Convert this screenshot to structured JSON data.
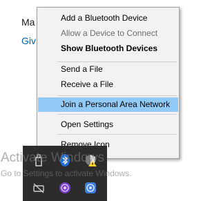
{
  "background": {
    "line1": "Ma",
    "line2": "Giv"
  },
  "menu": {
    "items": [
      {
        "label": "Add a Bluetooth Device"
      },
      {
        "label": "Allow a Device to Connect"
      },
      {
        "label": "Show Bluetooth Devices"
      },
      {
        "label": "Send a File"
      },
      {
        "label": "Receive a File"
      },
      {
        "label": "Join a Personal Area Network"
      },
      {
        "label": "Open Settings"
      },
      {
        "label": "Remove Icon"
      }
    ]
  },
  "watermark": {
    "title": "Activate Windows",
    "subtitle": "Go to Settings to activate Windows."
  },
  "tray_icons": [
    "usb-drive-icon",
    "bluetooth-icon",
    "defender-warning-icon",
    "camera-off-icon",
    "tor-browser-icon",
    "vpn-shield-icon"
  ],
  "colors": {
    "highlight": "#91c9f7",
    "link": "#0063b1",
    "tray_bg": "#2c2c2c"
  }
}
